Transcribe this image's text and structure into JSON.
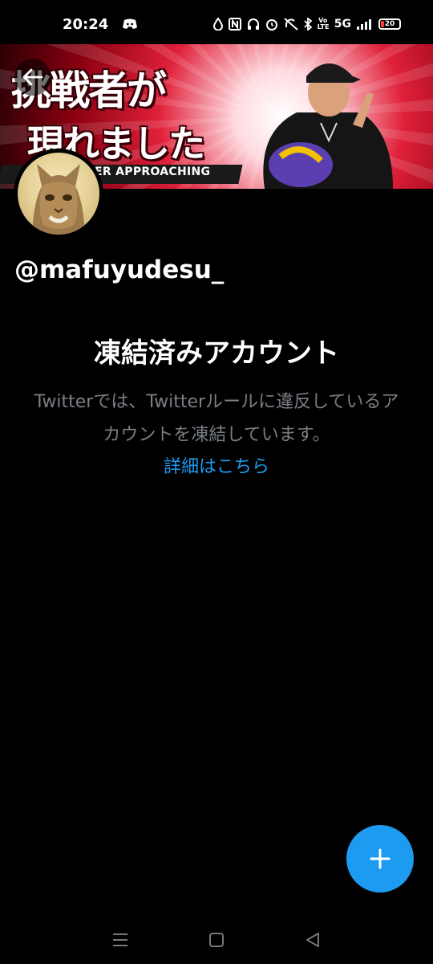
{
  "status_bar": {
    "time": "20:24",
    "network": "5G",
    "volte": "Vo LTE",
    "battery": "20"
  },
  "banner": {
    "headline_line1": "挑戦者が",
    "headline_line2": "現れました",
    "strip_text": "ER APPROACHING"
  },
  "profile": {
    "handle": "@mafuyudesu_"
  },
  "suspended": {
    "title": "凍結済みアカウント",
    "message": "Twitterでは、Twitterルールに違反しているアカウントを凍結しています。",
    "link": "詳細はこちら"
  },
  "colors": {
    "accent": "#1d9bf0",
    "background": "#000000",
    "muted_text": "#7a7f85",
    "battery_low": "#ff3b30"
  }
}
